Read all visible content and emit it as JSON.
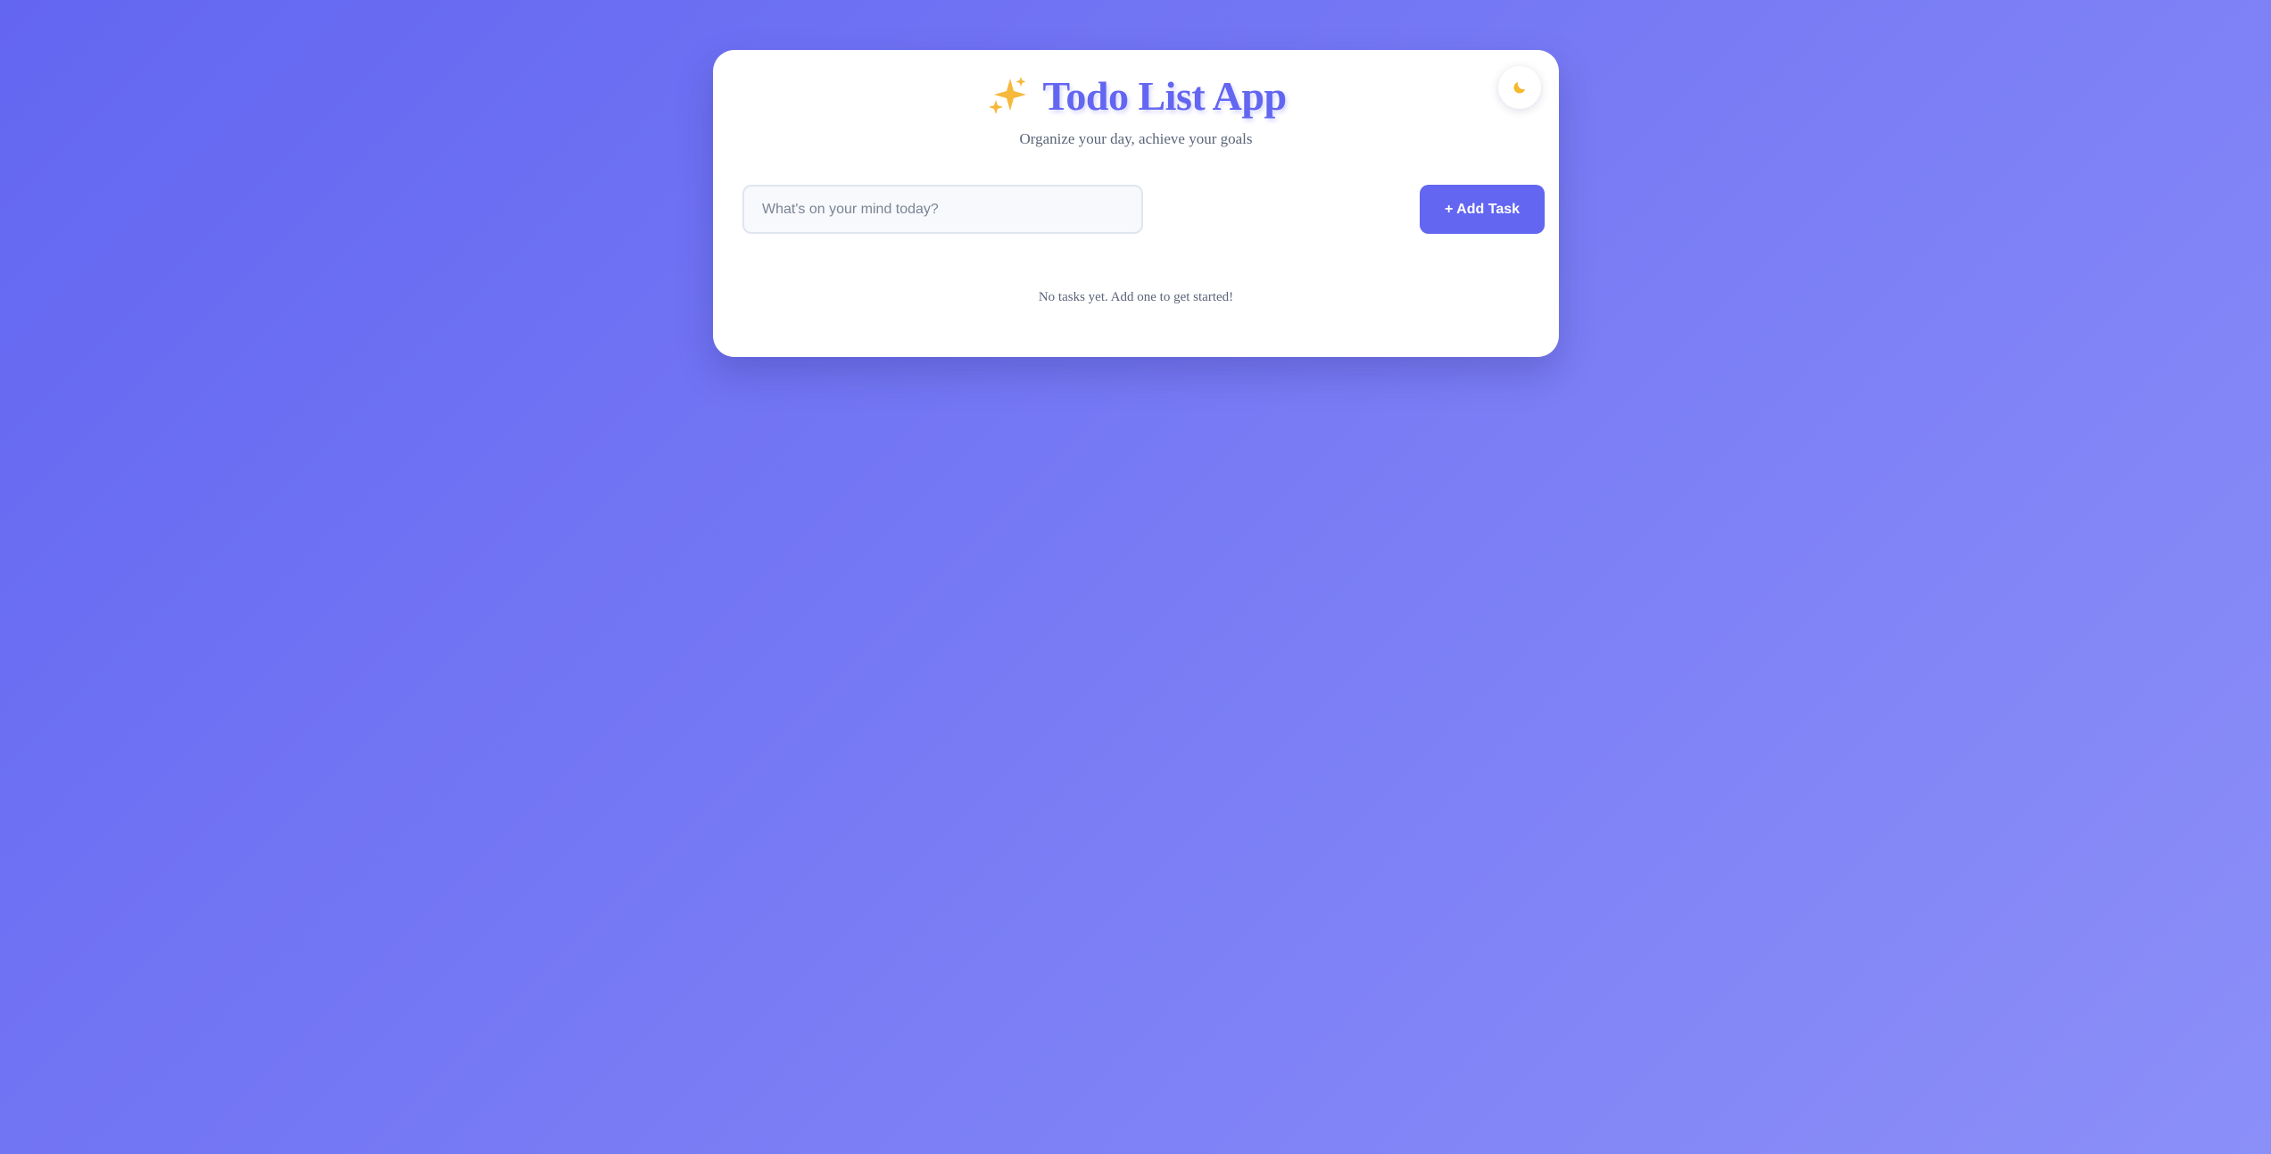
{
  "app": {
    "title": "Todo List App",
    "subtitle": "Organize your day, achieve your goals",
    "title_icon": "sparkles-icon"
  },
  "theme_toggle": {
    "icon": "moon-icon"
  },
  "task_form": {
    "input_value": "",
    "input_placeholder": "What's on your mind today?",
    "add_button_label": "+ Add Task"
  },
  "task_list": {
    "items": [],
    "empty_message": "No tasks yet. Add one to get started!"
  },
  "colors": {
    "accent": "#6366f1",
    "background_start": "#6366f1",
    "background_end": "#8b8ff8",
    "card": "#ffffff",
    "muted_text": "#5b6478",
    "sparkle": "#f6b93b",
    "moon": "#f4b82c"
  }
}
